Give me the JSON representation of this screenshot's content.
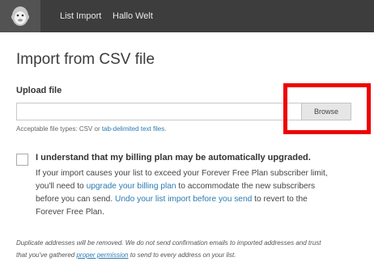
{
  "nav": {
    "logo": "mailchimp-freddie-icon",
    "links": [
      "List Import",
      "Hallo Welt"
    ]
  },
  "page": {
    "title": "Import from CSV file"
  },
  "upload": {
    "label": "Upload file",
    "input_value": "",
    "browse_label": "Browse",
    "hint_prefix": "Acceptable file types: CSV or ",
    "hint_link": "tab-delimited text files",
    "hint_suffix": "."
  },
  "billing": {
    "checked": false,
    "title": "I understand that my billing plan may be automatically upgraded.",
    "line1": "If your import causes your list to exceed your Forever Free Plan subscriber limit,",
    "line2_prefix": "you'll need to ",
    "line2_link": "upgrade your billing plan",
    "line2_suffix": " to accommodate the new subscribers",
    "line3_prefix": "before you can send. ",
    "line3_link": "Undo your list import before you send",
    "line3_suffix": " to revert to the",
    "line4": "Forever Free Plan."
  },
  "footer": {
    "line1": "Duplicate addresses will be removed. We do not send confirmation emails to imported addresses and trust",
    "line2_prefix": "that you've gathered ",
    "line2_link": "proper permission",
    "line2_suffix": " to send to every address on your list."
  },
  "colors": {
    "topbar": "#3d3d3d",
    "link": "#2b7cb0",
    "highlight": "#ee0000"
  }
}
